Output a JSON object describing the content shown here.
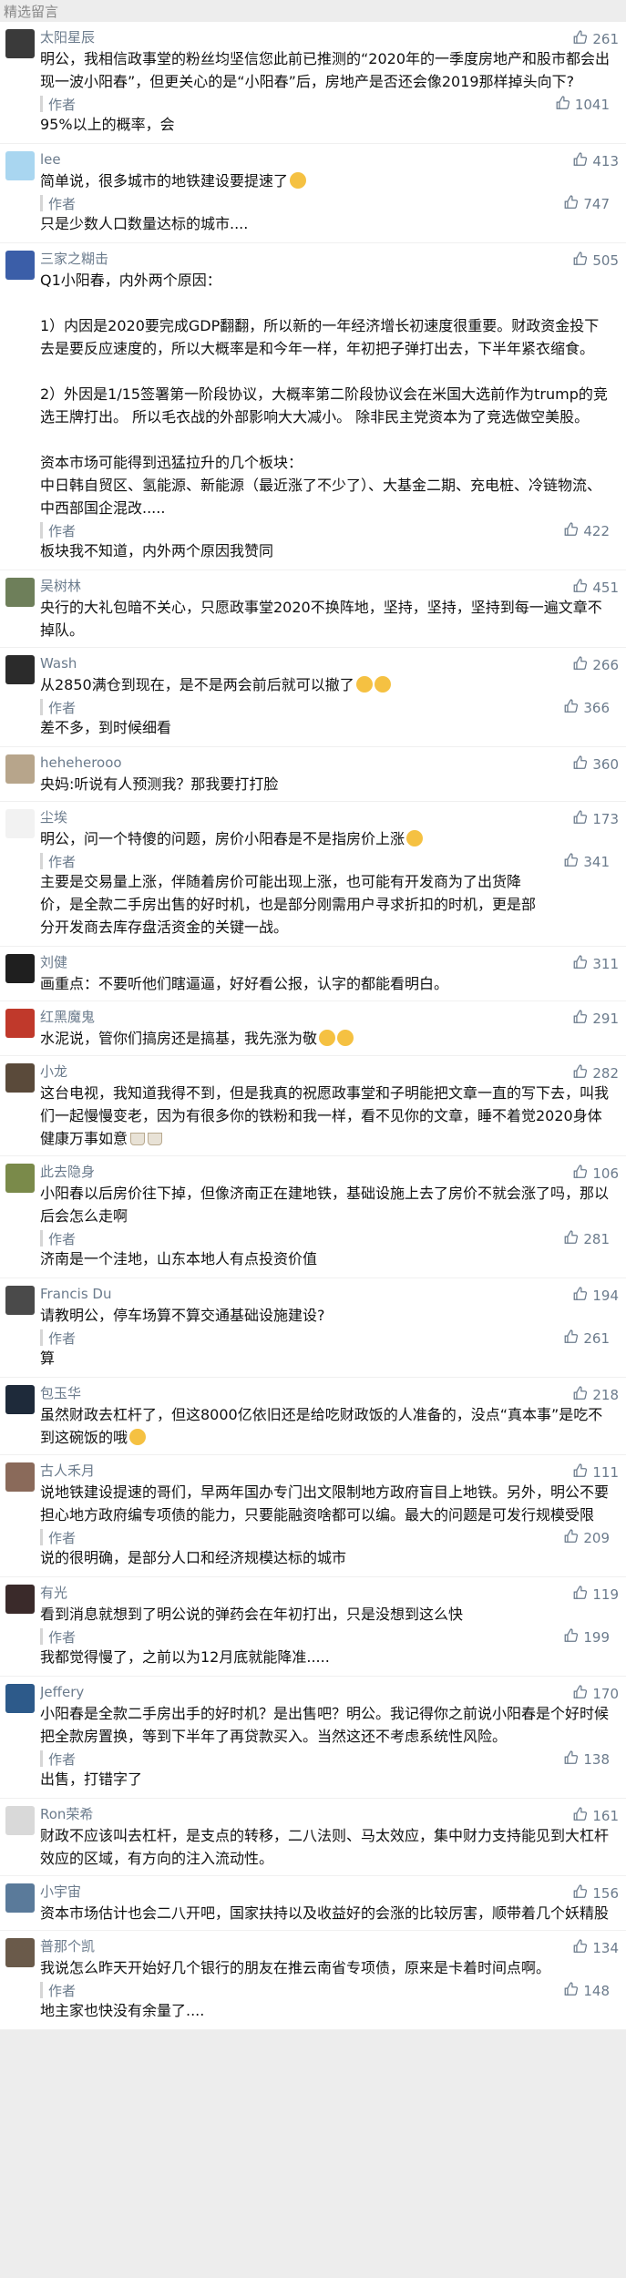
{
  "section_title": "精选留言",
  "reply_label": "作者",
  "colors": {
    "name": "#6b7b8c",
    "accent_like": "#6b7b8c",
    "text": "#111111",
    "reply_bar": "#d6d6d6"
  },
  "comments": [
    {
      "avatar_color": "#3a3a3a",
      "avatar_icon": "person-dark-avatar",
      "name": "太阳星辰",
      "likes": "261",
      "text": "明公，我相信政事堂的粉丝均坚信您此前已推测的“2020年的一季度房地产和股市都会出现一波小阳春”，但更关心的是“小阳春”后，房地产是否还会像2019那样掉头向下?",
      "emoji": "",
      "reply_text": "95%以上的概率，会",
      "reply_likes": "1041"
    },
    {
      "avatar_color": "#a9d6f0",
      "avatar_icon": "blue-sky-avatar",
      "name": "lee",
      "likes": "413",
      "text": "简单说，很多城市的地铁建设要提速了",
      "emoji": "smile",
      "reply_text": "只是少数人口数量达标的城市....",
      "reply_likes": "747"
    },
    {
      "avatar_color": "#3b5ea8",
      "avatar_icon": "flag-avatar",
      "name": "三家之糊击",
      "likes": "505",
      "text": "Q1小阳春，内外两个原因：\n\n1）内因是2020要完成GDP翻翻，所以新的一年经济增长初速度很重要。财政资金投下去是要反应速度的，所以大概率是和今年一样，年初把子弹打出去，下半年紧衣缩食。\n\n2）外因是1/15签署第一阶段协议，大概率第二阶段协议会在米国大选前作为trump的竞选王牌打出。 所以毛衣战的外部影响大大减小。 除非民主党资本为了竞选做空美股。\n\n资本市场可能得到迅猛拉升的几个板块：\n中日韩自贸区、氢能源、新能源（最近涨了不少了）、大基金二期、充电桩、冷链物流、中西部国企混改.....",
      "emoji": "",
      "reply_text": "板块我不知道，内外两个原因我赞同",
      "reply_likes": "422"
    },
    {
      "avatar_color": "#6e7f5a",
      "avatar_icon": "landscape-avatar",
      "name": "吴树林",
      "likes": "451",
      "text": "央行的大礼包暗不关心，只愿政事堂2020不换阵地，坚持，坚持，坚持到每一遍文章不掉队。",
      "emoji": "",
      "reply_text": "",
      "reply_likes": ""
    },
    {
      "avatar_color": "#2b2b2b",
      "avatar_icon": "cat-avatar",
      "name": "Wash",
      "likes": "266",
      "text": "从2850满仓到现在，是不是两会前后就可以撤了",
      "emoji": "grin2",
      "reply_text": "差不多，到时候细看",
      "reply_likes": "366"
    },
    {
      "avatar_color": "#b7a58b",
      "avatar_icon": "photo-avatar",
      "name": "heheherooo",
      "likes": "360",
      "text": "央妈:听说有人预测我？那我要打打脸",
      "emoji": "",
      "reply_text": "",
      "reply_likes": ""
    },
    {
      "avatar_color": "#f2f2f2",
      "avatar_icon": "cartoon-avatar",
      "name": "尘埃",
      "likes": "173",
      "text": "明公，问一个特傻的问题，房价小阳春是不是指房价上涨",
      "emoji": "laugh",
      "reply_text": "主要是交易量上涨，伴随着房价可能出现上涨，也可能有开发商为了出货降价，是全款二手房出售的好时机，也是部分刚需用户寻求折扣的时机，更是部分开发商去库存盘活资金的关键一战。",
      "reply_likes": "341"
    },
    {
      "avatar_color": "#1f1f1f",
      "avatar_icon": "neon-avatar",
      "name": "刘健",
      "likes": "311",
      "text": "画重点：不要听他们瞎逼逼，好好看公报，认字的都能看明白。",
      "emoji": "",
      "reply_text": "",
      "reply_likes": ""
    },
    {
      "avatar_color": "#c0392b",
      "avatar_icon": "red-figure-avatar",
      "name": "红黑魔鬼",
      "likes": "291",
      "text": "水泥说，管你们搞房还是搞基，我先涨为敬",
      "emoji": "laugh2",
      "reply_text": "",
      "reply_likes": ""
    },
    {
      "avatar_color": "#5a4a3a",
      "avatar_icon": "person-avatar",
      "name": "小龙",
      "likes": "282",
      "text": "这台电视，我知道我得不到，但是我真的祝愿政事堂和子明能把文章一直的写下去，叫我们一起慢慢变老，因为有很多你的铁粉和我一样，看不见你的文章，睡不着觉2020身体健康万事如意",
      "emoji": "cups",
      "reply_text": "",
      "reply_likes": ""
    },
    {
      "avatar_color": "#7a8a4a",
      "avatar_icon": "text-avatar",
      "name": "此去隐身",
      "likes": "106",
      "text": "小阳春以后房价往下掉，但像济南正在建地铁，基础设施上去了房价不就会涨了吗，那以后会怎么走啊",
      "emoji": "",
      "reply_text": "济南是一个洼地，山东本地人有点投资价值",
      "reply_likes": "281"
    },
    {
      "avatar_color": "#4a4a4a",
      "avatar_icon": "person-avatar",
      "name": "Francis Du",
      "likes": "194",
      "text": "请教明公，停车场算不算交通基础设施建设?",
      "emoji": "",
      "reply_text": "算",
      "reply_likes": "261"
    },
    {
      "avatar_color": "#1e2a3a",
      "avatar_icon": "dark-avatar",
      "name": "包玉华",
      "likes": "218",
      "text": "虽然财政去杠杆了，但这8000亿依旧还是给吃财政饭的人准备的，没点“真本事”是吃不到这碗饭的哦",
      "emoji": "smile2",
      "reply_text": "",
      "reply_likes": ""
    },
    {
      "avatar_color": "#8a6a5a",
      "avatar_icon": "person-avatar",
      "name": "古人禾月",
      "likes": "111",
      "text": "说地铁建设提速的哥们，早两年国办专门出文限制地方政府盲目上地铁。另外，明公不要担心地方政府编专项债的能力，只要能融资啥都可以编。最大的问题是可发行规模受限",
      "emoji": "",
      "reply_text": "说的很明确，是部分人口和经济规模达标的城市",
      "reply_likes": "209"
    },
    {
      "avatar_color": "#3a2a2a",
      "avatar_icon": "person-avatar",
      "name": "有光",
      "likes": "119",
      "text": "看到消息就想到了明公说的弹药会在年初打出，只是没想到这么快",
      "emoji": "",
      "reply_text": "我都觉得慢了，之前以为12月底就能降准.....",
      "reply_likes": "199"
    },
    {
      "avatar_color": "#2d5a8a",
      "avatar_icon": "person-avatar",
      "name": "Jeffery",
      "likes": "170",
      "text": "小阳春是全款二手房出手的好时机？是出售吧？明公。我记得你之前说小阳春是个好时候把全款房置换，等到下半年了再贷款买入。当然这还不考虑系统性风险。",
      "emoji": "",
      "reply_text": "出售，打错字了",
      "reply_likes": "138"
    },
    {
      "avatar_color": "#d9d9d9",
      "avatar_icon": "person-avatar",
      "name": "Ron荣希",
      "likes": "161",
      "text": "财政不应该叫去杠杆，是支点的转移，二八法则、马太效应，集中财力支持能见到大杠杆效应的区域，有方向的注入流动性。",
      "emoji": "",
      "reply_text": "",
      "reply_likes": ""
    },
    {
      "avatar_color": "#5a7a9a",
      "avatar_icon": "person-avatar",
      "name": "小宇宙",
      "likes": "156",
      "text": "资本市场估计也会二八开吧，国家扶持以及收益好的会涨的比较厉害，顺带着几个妖精股",
      "emoji": "",
      "reply_text": "",
      "reply_likes": ""
    },
    {
      "avatar_color": "#6a5a4a",
      "avatar_icon": "person-avatar",
      "name": "普那个凯",
      "likes": "134",
      "text": "我说怎么昨天开始好几个银行的朋友在推云南省专项债，原来是卡着时间点啊。",
      "emoji": "",
      "reply_text": "地主家也快没有余量了....",
      "reply_likes": "148"
    }
  ]
}
